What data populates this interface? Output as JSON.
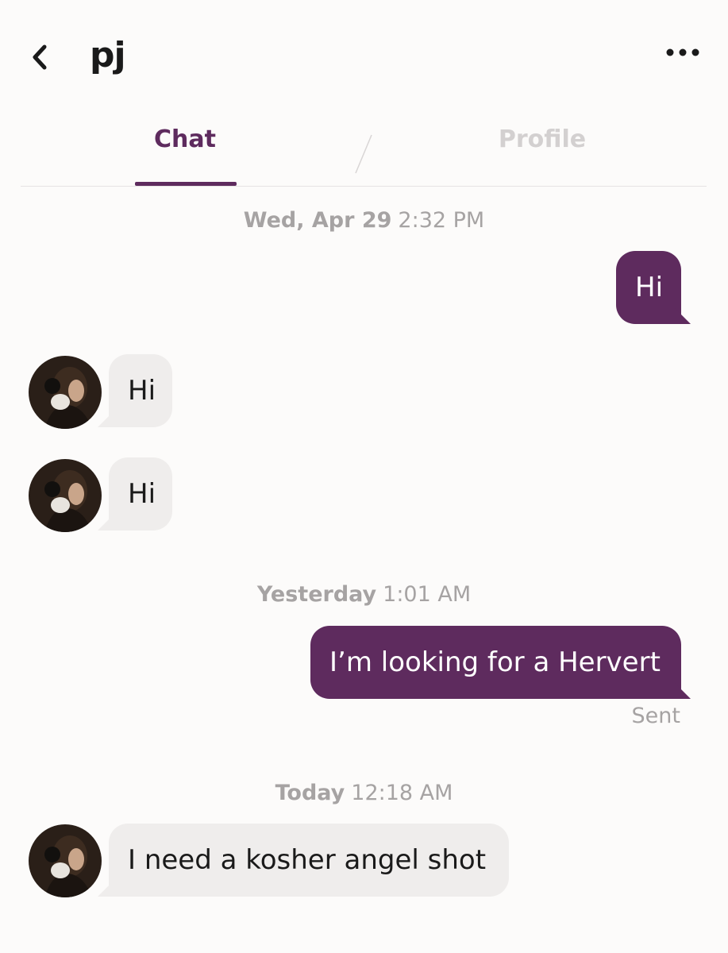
{
  "app": {
    "accent_color": "#5e2b5e"
  },
  "header": {
    "title": "pj",
    "back_icon": "chevron-left-icon",
    "more_icon": "more-horizontal-icon"
  },
  "tabs": [
    {
      "label": "Chat",
      "active": true
    },
    {
      "label": "Profile",
      "active": false
    }
  ],
  "conversation": {
    "timestamps": [
      {
        "day": "Wed, Apr 29",
        "time": "2:32 PM"
      },
      {
        "day": "Yesterday",
        "time": "1:01 AM"
      },
      {
        "day": "Today",
        "time": "12:18 AM"
      }
    ],
    "messages": [
      {
        "direction": "outgoing",
        "text": "Hi"
      },
      {
        "direction": "incoming",
        "text": "Hi"
      },
      {
        "direction": "incoming",
        "text": "Hi"
      },
      {
        "direction": "outgoing",
        "text": "I’m looking for a Hervert",
        "status": "Sent"
      },
      {
        "direction": "incoming",
        "text": "I need a kosher angel shot"
      }
    ]
  }
}
